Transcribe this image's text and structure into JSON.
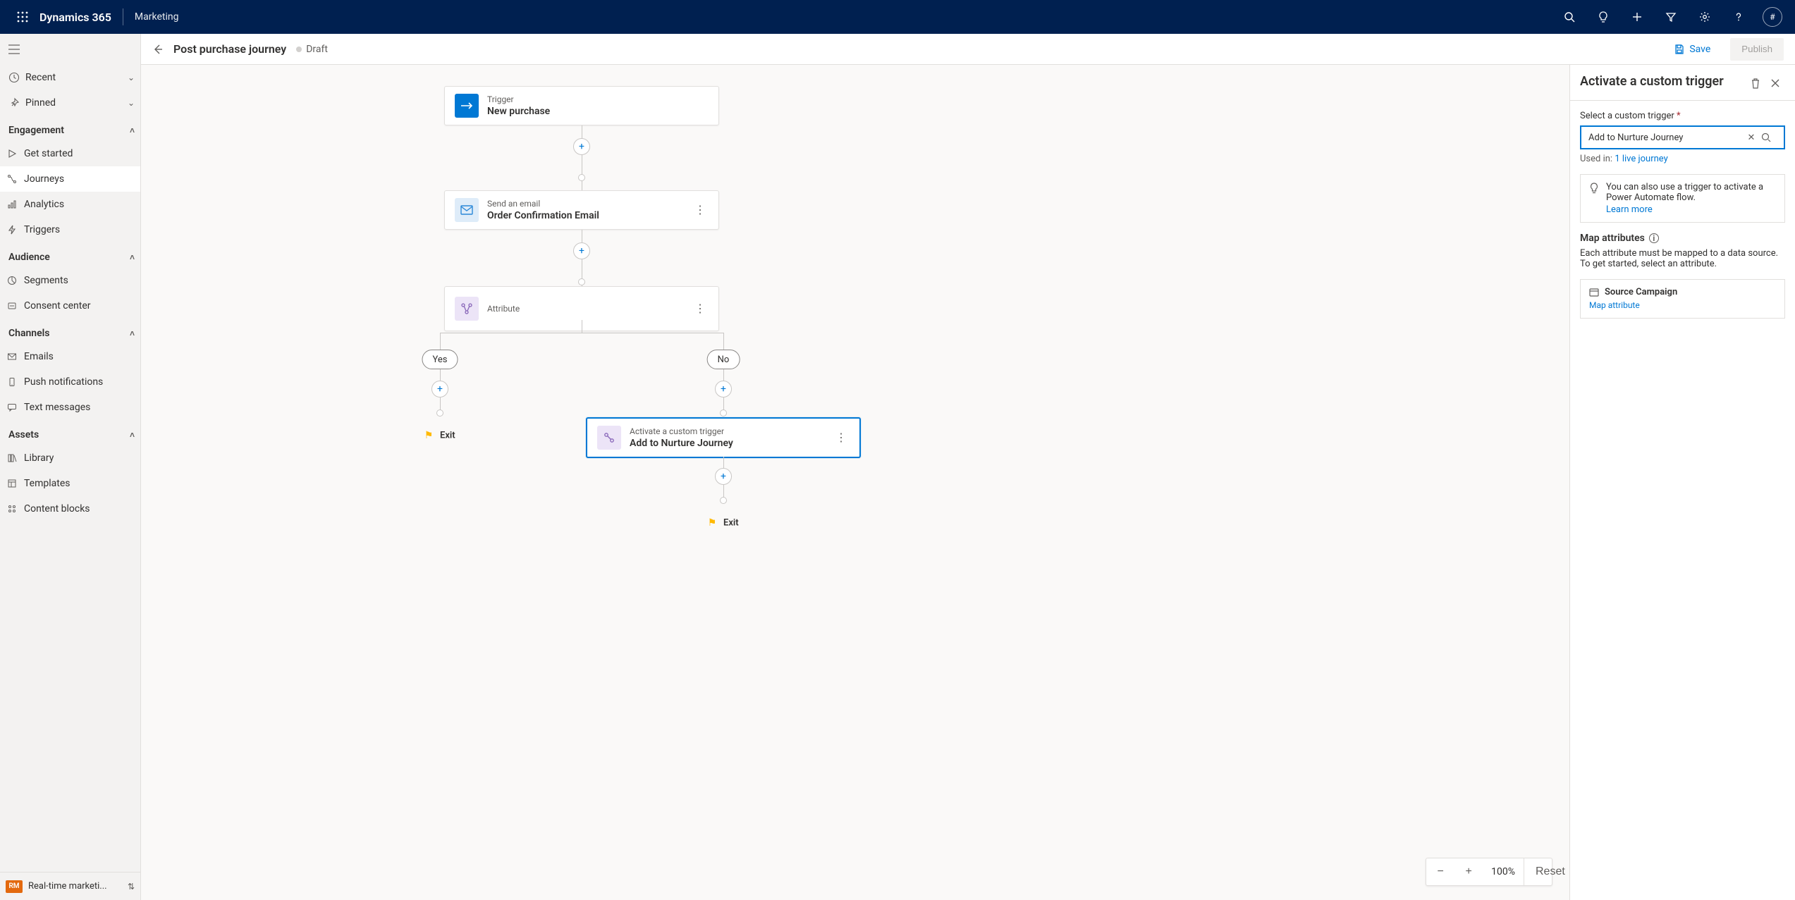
{
  "topbar": {
    "product": "Dynamics 365",
    "app": "Marketing",
    "avatar": "#"
  },
  "sidebar": {
    "recent": "Recent",
    "pinned": "Pinned",
    "sections": {
      "engagement": "Engagement",
      "audience": "Audience",
      "channels": "Channels",
      "assets": "Assets"
    },
    "items": {
      "getStarted": "Get started",
      "journeys": "Journeys",
      "analytics": "Analytics",
      "triggers": "Triggers",
      "segments": "Segments",
      "consent": "Consent center",
      "emails": "Emails",
      "push": "Push notifications",
      "text": "Text messages",
      "library": "Library",
      "templates": "Templates",
      "contentBlocks": "Content blocks"
    },
    "footer": {
      "badge": "RM",
      "label": "Real-time marketi..."
    }
  },
  "cmdbar": {
    "breadcrumb": "Post purchase journey",
    "status": "Draft",
    "save": "Save",
    "publish": "Publish"
  },
  "flow": {
    "trigger": {
      "type": "Trigger",
      "name": "New purchase"
    },
    "email": {
      "type": "Send an email",
      "name": "Order Confirmation Email"
    },
    "attribute": {
      "type": "Attribute"
    },
    "branchYes": "Yes",
    "branchNo": "No",
    "custom": {
      "type": "Activate a custom trigger",
      "name": "Add to Nurture Journey"
    },
    "exit": "Exit"
  },
  "zoom": {
    "level": "100%",
    "reset": "Reset"
  },
  "panel": {
    "title": "Activate a custom trigger",
    "selectLabel": "Select a custom trigger",
    "selectedValue": "Add to Nurture Journey",
    "usedInPrefix": "Used in:",
    "usedInLink": "1 live journey",
    "tip": "You can also use a trigger to activate a Power Automate flow.",
    "tipLink": "Learn more",
    "mapTitle": "Map attributes",
    "mapHelp": "Each attribute must be mapped to a data source. To get started, select an attribute.",
    "attr": {
      "name": "Source Campaign",
      "link": "Map attribute"
    }
  }
}
